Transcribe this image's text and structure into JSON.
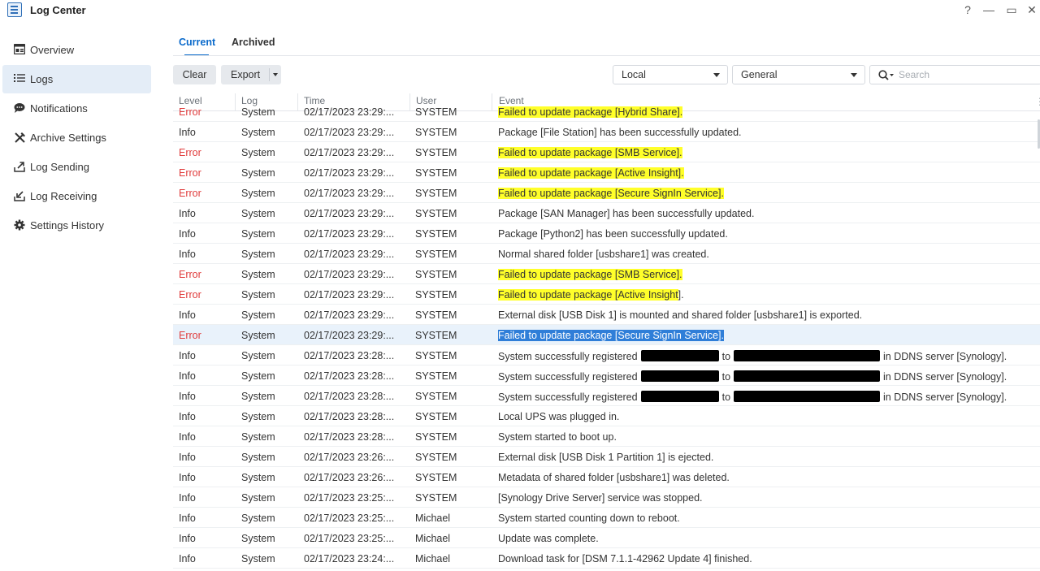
{
  "window": {
    "title": "Log Center",
    "controls": [
      "?",
      "—",
      "▭",
      "✕"
    ]
  },
  "sidebar": {
    "items": [
      {
        "label": "Overview",
        "icon": "overview-icon",
        "active": false
      },
      {
        "label": "Logs",
        "icon": "list-icon",
        "active": true
      },
      {
        "label": "Notifications",
        "icon": "chat-bubble-icon",
        "active": false
      },
      {
        "label": "Archive Settings",
        "icon": "tools-icon",
        "active": false
      },
      {
        "label": "Log Sending",
        "icon": "upload-icon",
        "active": false
      },
      {
        "label": "Log Receiving",
        "icon": "download-icon",
        "active": false
      },
      {
        "label": "Settings History",
        "icon": "gear-icon",
        "active": false
      }
    ]
  },
  "tabs": [
    {
      "label": "Current",
      "active": true
    },
    {
      "label": "Archived",
      "active": false
    }
  ],
  "toolbar": {
    "clear_label": "Clear",
    "export_label": "Export",
    "location_select": "Local",
    "type_select": "General",
    "search_placeholder": "Search"
  },
  "table": {
    "columns": [
      "Level",
      "Log",
      "Time",
      "User",
      "Event"
    ],
    "rows": [
      {
        "level": "Error",
        "log": "System",
        "time": "02/17/2023 23:29:...",
        "user": "SYSTEM",
        "event": "Failed to update package [Hybrid Share].",
        "highlight": "full"
      },
      {
        "level": "Info",
        "log": "System",
        "time": "02/17/2023 23:29:...",
        "user": "SYSTEM",
        "event": "Package [File Station] has been successfully updated."
      },
      {
        "level": "Error",
        "log": "System",
        "time": "02/17/2023 23:29:...",
        "user": "SYSTEM",
        "event": "Failed to update package [SMB Service].",
        "highlight": "full"
      },
      {
        "level": "Error",
        "log": "System",
        "time": "02/17/2023 23:29:...",
        "user": "SYSTEM",
        "event": "Failed to update package [Active Insight].",
        "highlight": "full"
      },
      {
        "level": "Error",
        "log": "System",
        "time": "02/17/2023 23:29:...",
        "user": "SYSTEM",
        "event": "Failed to update package [Secure SignIn Service].",
        "highlight": "full"
      },
      {
        "level": "Info",
        "log": "System",
        "time": "02/17/2023 23:29:...",
        "user": "SYSTEM",
        "event": "Package [SAN Manager] has been successfully updated."
      },
      {
        "level": "Info",
        "log": "System",
        "time": "02/17/2023 23:29:...",
        "user": "SYSTEM",
        "event": "Package [Python2] has been successfully updated."
      },
      {
        "level": "Info",
        "log": "System",
        "time": "02/17/2023 23:29:...",
        "user": "SYSTEM",
        "event": "Normal shared folder [usbshare1] was created."
      },
      {
        "level": "Error",
        "log": "System",
        "time": "02/17/2023 23:29:...",
        "user": "SYSTEM",
        "event": "Failed to update package [SMB Service].",
        "highlight": "full"
      },
      {
        "level": "Error",
        "log": "System",
        "time": "02/17/2023 23:29:...",
        "user": "SYSTEM",
        "event": "Failed to update package [Active Insight].",
        "highlight": "partial",
        "hl_text": "Failed to update package [Active Insight",
        "rest_text": "]."
      },
      {
        "level": "Info",
        "log": "System",
        "time": "02/17/2023 23:29:...",
        "user": "SYSTEM",
        "event": "External disk [USB Disk 1] is mounted and shared folder [usbshare1] is exported."
      },
      {
        "level": "Error",
        "log": "System",
        "time": "02/17/2023 23:29:...",
        "user": "SYSTEM",
        "event": "Failed to update package [Secure SignIn Service].",
        "highlight": "selected",
        "selected": true
      },
      {
        "level": "Info",
        "log": "System",
        "time": "02/17/2023 23:28:...",
        "user": "SYSTEM",
        "event": "System successfully registered [redacted] to [redacted] in DDNS server [Synology].",
        "redacted": true,
        "ev_a": "System successfully registered",
        "ev_b": "to",
        "ev_c": "in DDNS server [Synology]."
      },
      {
        "level": "Info",
        "log": "System",
        "time": "02/17/2023 23:28:...",
        "user": "SYSTEM",
        "event": "System successfully registered [redacted] to [redacted] in DDNS server [Synology].",
        "redacted": true,
        "ev_a": "System successfully registered",
        "ev_b": "to",
        "ev_c": "in DDNS server [Synology]."
      },
      {
        "level": "Info",
        "log": "System",
        "time": "02/17/2023 23:28:...",
        "user": "SYSTEM",
        "event": "System successfully registered [redacted] to [redacted] in DDNS server [Synology].",
        "redacted": true,
        "ev_a": "System successfully registered",
        "ev_b": "to",
        "ev_c": "in DDNS server [Synology]."
      },
      {
        "level": "Info",
        "log": "System",
        "time": "02/17/2023 23:28:...",
        "user": "SYSTEM",
        "event": "Local UPS was plugged in."
      },
      {
        "level": "Info",
        "log": "System",
        "time": "02/17/2023 23:28:...",
        "user": "SYSTEM",
        "event": "System started to boot up."
      },
      {
        "level": "Info",
        "log": "System",
        "time": "02/17/2023 23:26:...",
        "user": "SYSTEM",
        "event": "External disk [USB Disk 1 Partition 1] is ejected."
      },
      {
        "level": "Info",
        "log": "System",
        "time": "02/17/2023 23:26:...",
        "user": "SYSTEM",
        "event": "Metadata of shared folder [usbshare1] was deleted."
      },
      {
        "level": "Info",
        "log": "System",
        "time": "02/17/2023 23:25:...",
        "user": "SYSTEM",
        "event": "[Synology Drive Server] service was stopped."
      },
      {
        "level": "Info",
        "log": "System",
        "time": "02/17/2023 23:25:...",
        "user": "Michael",
        "event": "System started counting down to reboot."
      },
      {
        "level": "Info",
        "log": "System",
        "time": "02/17/2023 23:25:...",
        "user": "Michael",
        "event": "Update was complete."
      },
      {
        "level": "Info",
        "log": "System",
        "time": "02/17/2023 23:24:...",
        "user": "Michael",
        "event": "Download task for [DSM 7.1.1-42962 Update 4] finished."
      }
    ]
  },
  "colors": {
    "accent": "#0a6acb",
    "error": "#e03b3b",
    "highlight": "#ffff2a",
    "selection": "#2f7ed8"
  }
}
